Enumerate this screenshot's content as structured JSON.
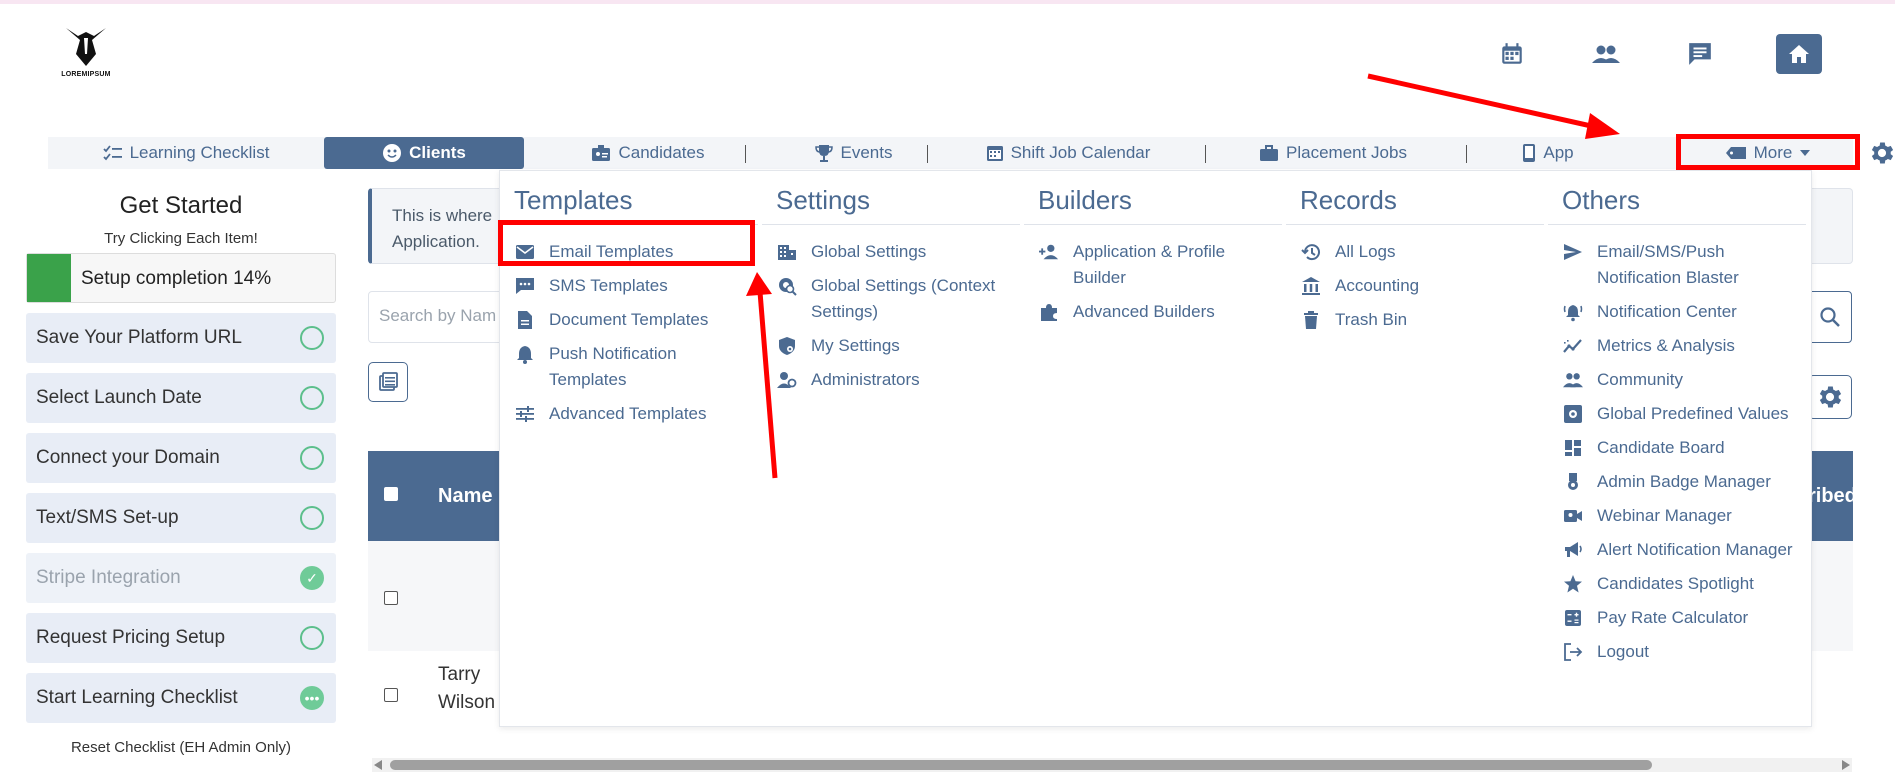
{
  "logo": {
    "text": "LOREMIPSUM"
  },
  "top_icons": [
    "calendar-icon",
    "people-icon",
    "chat-icon",
    "home-icon"
  ],
  "nav": {
    "items": [
      {
        "label": "Learning Checklist",
        "icon": "checklist-icon"
      },
      {
        "label": "Clients",
        "icon": "face-icon",
        "active": true
      },
      {
        "label": "Candidates",
        "icon": "id-badge-icon"
      },
      {
        "label": "Events",
        "icon": "trophy-icon"
      },
      {
        "label": "Shift Job Calendar",
        "icon": "calendar-icon"
      },
      {
        "label": "Placement Jobs",
        "icon": "briefcase-icon"
      },
      {
        "label": "App",
        "icon": "phone-icon"
      }
    ],
    "more_label": "More",
    "more_icon": "tag-icon"
  },
  "sidebar": {
    "title": "Get Started",
    "subtitle": "Try Clicking Each Item!",
    "progress_label": "Setup completion 14%",
    "progress_fraction": 0.14,
    "items": [
      {
        "label": "Save Your Platform URL",
        "state": "todo"
      },
      {
        "label": "Select Launch Date",
        "state": "todo"
      },
      {
        "label": "Connect your Domain",
        "state": "todo"
      },
      {
        "label": "Text/SMS Set-up",
        "state": "todo"
      },
      {
        "label": "Stripe Integration",
        "state": "done"
      },
      {
        "label": "Request Pricing Setup",
        "state": "todo"
      },
      {
        "label": "Start Learning Checklist",
        "state": "in-progress"
      }
    ],
    "reset_label": "Reset Checklist (EH Admin Only)"
  },
  "main": {
    "info_text_line1": "This is where",
    "info_text_line2": "Application.",
    "search_placeholder": "Search by Nam",
    "table_header_name": "Name",
    "table_header_right": "ribed",
    "row_name_line1": "Tarry",
    "row_name_line2": "Wilson"
  },
  "dropdown": {
    "templates": {
      "title": "Templates",
      "items": [
        "Email Templates",
        "SMS Templates",
        "Document Templates",
        "Push Notification Templates",
        "Advanced Templates"
      ]
    },
    "settings": {
      "title": "Settings",
      "items": [
        "Global Settings",
        "Global Settings (Context Settings)",
        "My Settings",
        "Administrators"
      ]
    },
    "builders": {
      "title": "Builders",
      "items": [
        "Application & Profile Builder",
        "Advanced Builders"
      ]
    },
    "records": {
      "title": "Records",
      "items": [
        "All Logs",
        "Accounting",
        "Trash Bin"
      ]
    },
    "others": {
      "title": "Others",
      "items": [
        "Email/SMS/Push Notification Blaster",
        "Notification Center",
        "Metrics & Analysis",
        "Community",
        "Global Predefined Values",
        "Candidate Board",
        "Admin Badge Manager",
        "Webinar Manager",
        "Alert Notification Manager",
        "Candidates Spotlight",
        "Pay Rate Calculator",
        "Logout"
      ]
    }
  },
  "colors": {
    "accent": "#4b6a91",
    "highlight": "#ff0000",
    "success": "#3aa24a"
  }
}
